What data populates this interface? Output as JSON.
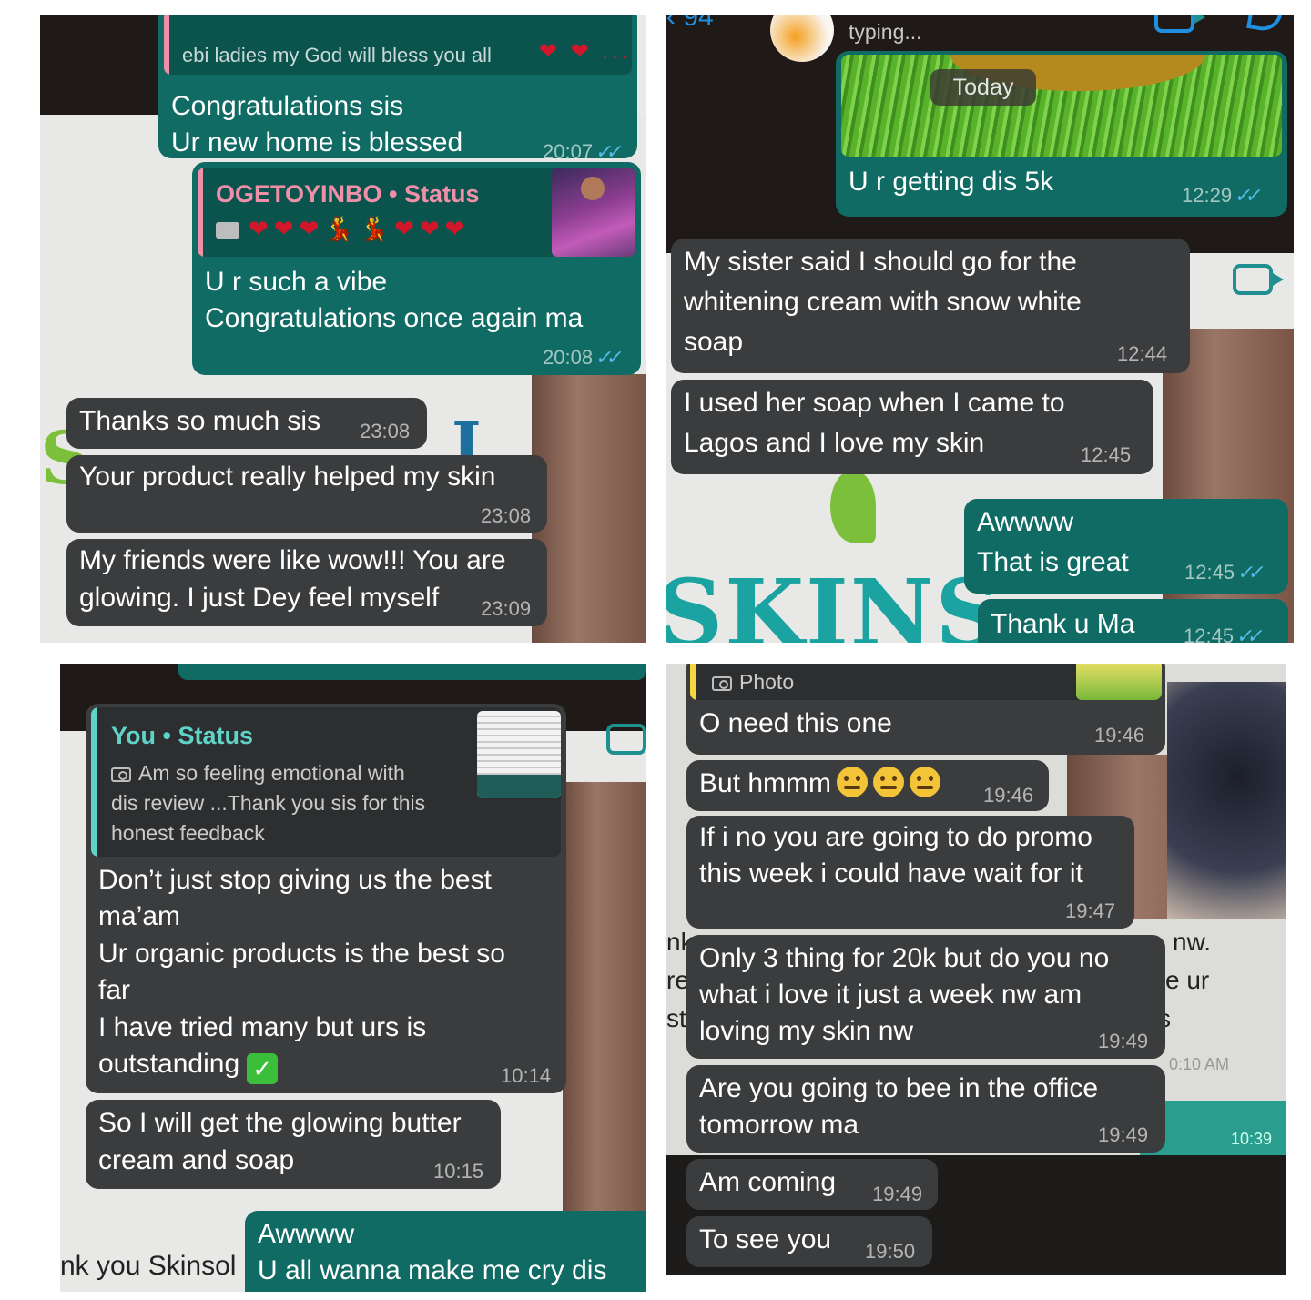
{
  "panel1": {
    "quoted_text": "ebi ladies my God will bless you all",
    "quoted_hearts": "❤ ❤ ...",
    "msg1_line1": "Congratulations sis",
    "msg1_line2": "Ur new home is blessed",
    "msg1_time": "20:07",
    "status_quote_name": "OGETOYINBO • Status",
    "status_quote_emojis": "❤❤❤💃💃❤❤❤",
    "msg2_line1": "U r such a vibe",
    "msg2_line2": "Congratulations once again ma",
    "msg2_time": "20:08",
    "msg3": "Thanks so much sis",
    "msg3_time": "23:08",
    "msg4": "Your product really helped my skin",
    "msg4_time": "23:08",
    "msg5_line1": "My friends were like wow!!! You are",
    "msg5_line2": "glowing. I just Dey feel myself",
    "msg5_time": "23:09",
    "bg_letters": "S",
    "bg_letters2": "I"
  },
  "panel2": {
    "header_count": "94",
    "header_status": "typing...",
    "date_chip": "Today",
    "msg1": "U r getting dis 5k",
    "msg1_time": "12:29",
    "msg2_line1": "My sister said I should go for the",
    "msg2_line2": "whitening cream with snow white",
    "msg2_line3": "soap",
    "msg2_time": "12:44",
    "msg3_line1": "I used her soap when I came to",
    "msg3_line2": "Lagos and I love my skin",
    "msg3_time": "12:45",
    "msg4_line1": "Awwww",
    "msg4_line2": "That is great",
    "msg4_time": "12:45",
    "msg5": "Thank u Ma",
    "msg5_time": "12:45",
    "bg_letters": "SKINS"
  },
  "panel3": {
    "status_quote_name": "You • Status",
    "status_quote_line1": "Am so feeling emotional with",
    "status_quote_line2": "dis review ...Thank you sis for this",
    "status_quote_line3": "honest feedback",
    "msg1_line1": "Don’t just stop giving us the best",
    "msg1_line2": "ma’am",
    "msg1_line3": "Ur organic products is the best so",
    "msg1_line4": "far",
    "msg1_line5": "I have tried many but urs is",
    "msg1_line6": "outstanding",
    "msg1_time": "10:14",
    "msg2_line1": "So I will get the glowing butter",
    "msg2_line2": "cream and soap",
    "msg2_time": "10:15",
    "msg3_line1": "Awwww",
    "msg3_line2": "U all wanna make me cry dis",
    "bg_text": "nk you Skinsol",
    "bg_letter": "S"
  },
  "panel4": {
    "quoted_label": "Photo",
    "msg1": "O need this one",
    "msg1_time": "19:46",
    "msg2": "But hmmm",
    "msg2_time": "19:46",
    "msg3_line1": "If i no you are going to do promo",
    "msg3_line2": "this week i could have wait for it",
    "msg3_time": "19:47",
    "msg4_line1": "Only 3 thing for 20k but do you no",
    "msg4_line2": "what i love it just a week nw am",
    "msg4_line3": "loving my skin nw",
    "msg4_time": "19:49",
    "msg5_line1": "Are you going to bee in the office",
    "msg5_line2": "tomorrow ma",
    "msg5_time": "19:49",
    "msg6": "Am coming",
    "msg6_time": "19:49",
    "msg7": "To see you",
    "msg7_time": "19:50",
    "bg_right1": "nw.",
    "bg_right2": "e ur",
    "bg_right3": "s",
    "bg_right4": "0:10 AM",
    "bg_right5": "10:39",
    "bg_left1": "nk",
    "bg_left2": "re",
    "bg_left3": "st"
  },
  "colors": {
    "incoming": "#3b3c3d",
    "outgoing": "#0f6b63",
    "read_ticks": "#53bdeb",
    "status_pink": "#f08fa8",
    "status_teal": "#5fd3c8"
  }
}
